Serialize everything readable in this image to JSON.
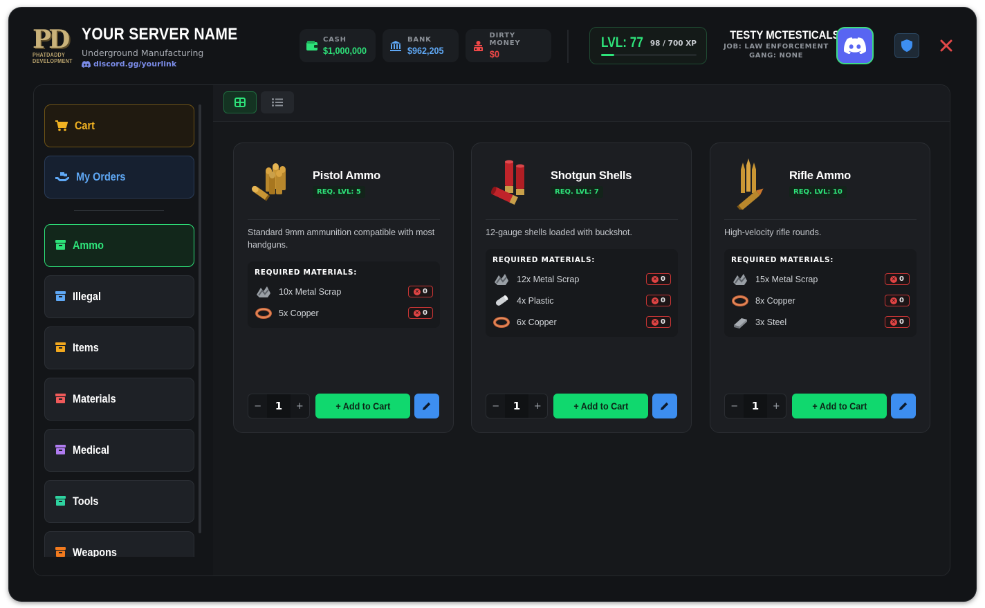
{
  "server": {
    "logo_text": "PD",
    "logo_sub1": "PHATDADDY",
    "logo_sub2": "DEVELOPMENT",
    "name": "YOUR SERVER NAME",
    "subtitle": "Underground Manufacturing",
    "discord_link": "discord.gg/yourlink"
  },
  "money": [
    {
      "label": "CASH",
      "value": "$1,000,000",
      "color": "#2ee37a",
      "icon": "wallet-icon"
    },
    {
      "label": "BANK",
      "value": "$962,205",
      "color": "#5fa8f5",
      "icon": "bank-icon"
    },
    {
      "label": "DIRTY MONEY",
      "value": "$0",
      "color": "#f04848",
      "icon": "dirty-money-icon"
    }
  ],
  "level": {
    "label": "LVL: 77",
    "xp": "98 / 700 XP",
    "progress": 0.14
  },
  "player": {
    "name": "TESTY MCTESTICALS",
    "job": "JOB: LAW ENFORCEMENT",
    "gang": "GANG: NONE"
  },
  "sidebar": {
    "cart": "Cart",
    "orders": "My Orders",
    "categories": [
      {
        "label": "Ammo",
        "color": "#2ee37a",
        "active": true
      },
      {
        "label": "Illegal",
        "color": "#5fa8f5"
      },
      {
        "label": "Items",
        "color": "#f2a81e"
      },
      {
        "label": "Materials",
        "color": "#f05a5a"
      },
      {
        "label": "Medical",
        "color": "#b07cf0"
      },
      {
        "label": "Tools",
        "color": "#2ed3a0"
      },
      {
        "label": "Weapons",
        "color": "#f27a1e"
      }
    ]
  },
  "view_modes": [
    "grid",
    "list"
  ],
  "products": [
    {
      "title": "Pistol Ammo",
      "req": "REQ. LVL: 5",
      "description": "Standard 9mm ammunition compatible with most handguns.",
      "materials_heading": "REQUIRED MATERIALS:",
      "materials": [
        {
          "name": "10x Metal Scrap",
          "have": "0",
          "icon": "metal-scrap-icon"
        },
        {
          "name": "5x Copper",
          "have": "0",
          "icon": "copper-icon"
        }
      ],
      "qty": "1",
      "add_label": "+ Add to Cart"
    },
    {
      "title": "Shotgun Shells",
      "req": "REQ. LVL: 7",
      "description": "12-gauge shells loaded with buckshot.",
      "materials_heading": "REQUIRED MATERIALS:",
      "materials": [
        {
          "name": "12x Metal Scrap",
          "have": "0",
          "icon": "metal-scrap-icon"
        },
        {
          "name": "4x Plastic",
          "have": "0",
          "icon": "plastic-icon"
        },
        {
          "name": "6x Copper",
          "have": "0",
          "icon": "copper-icon"
        }
      ],
      "qty": "1",
      "add_label": "+ Add to Cart"
    },
    {
      "title": "Rifle Ammo",
      "req": "REQ. LVL: 10",
      "description": "High-velocity rifle rounds.",
      "materials_heading": "REQUIRED MATERIALS:",
      "materials": [
        {
          "name": "15x Metal Scrap",
          "have": "0",
          "icon": "metal-scrap-icon"
        },
        {
          "name": "8x Copper",
          "have": "0",
          "icon": "copper-icon"
        },
        {
          "name": "3x Steel",
          "have": "0",
          "icon": "steel-icon"
        }
      ],
      "qty": "1",
      "add_label": "+ Add to Cart"
    }
  ]
}
